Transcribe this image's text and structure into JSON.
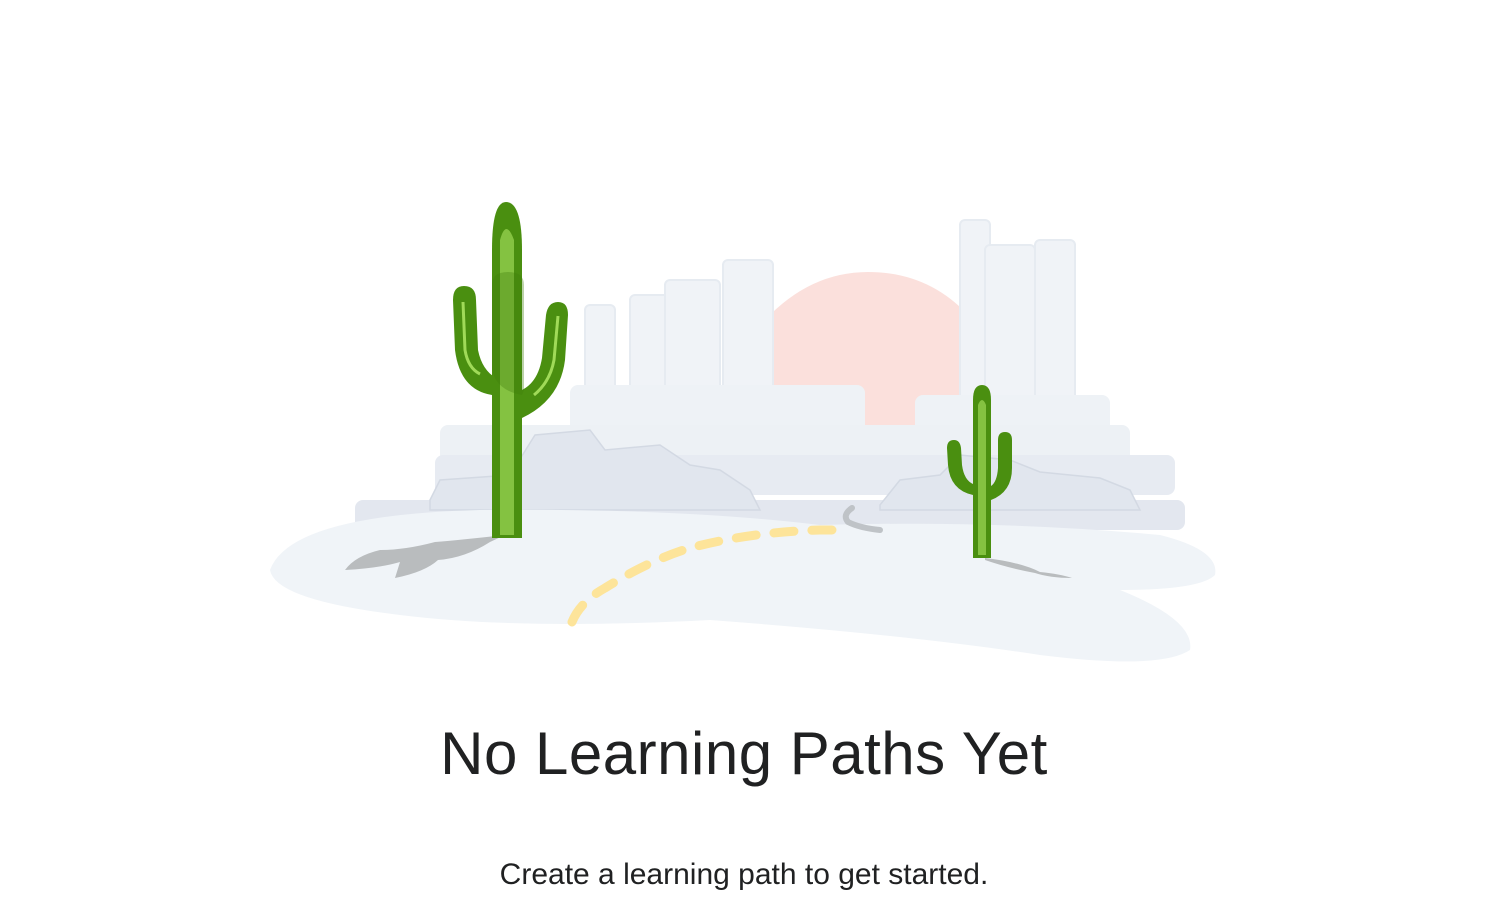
{
  "empty_state": {
    "illustration_name": "desert-cactus-illustration",
    "title": "No Learning Paths Yet",
    "subtitle": "Create a learning path to get started."
  },
  "colors": {
    "text": "#202122",
    "cactus_dark": "#4a8f10",
    "cactus_light": "#b5ec6a",
    "sun": "#fbe0dc",
    "city": "#eef2f7",
    "ground": "#f0f4f8",
    "road_dash": "#fde49a",
    "shadow": "#b9bcbe"
  }
}
